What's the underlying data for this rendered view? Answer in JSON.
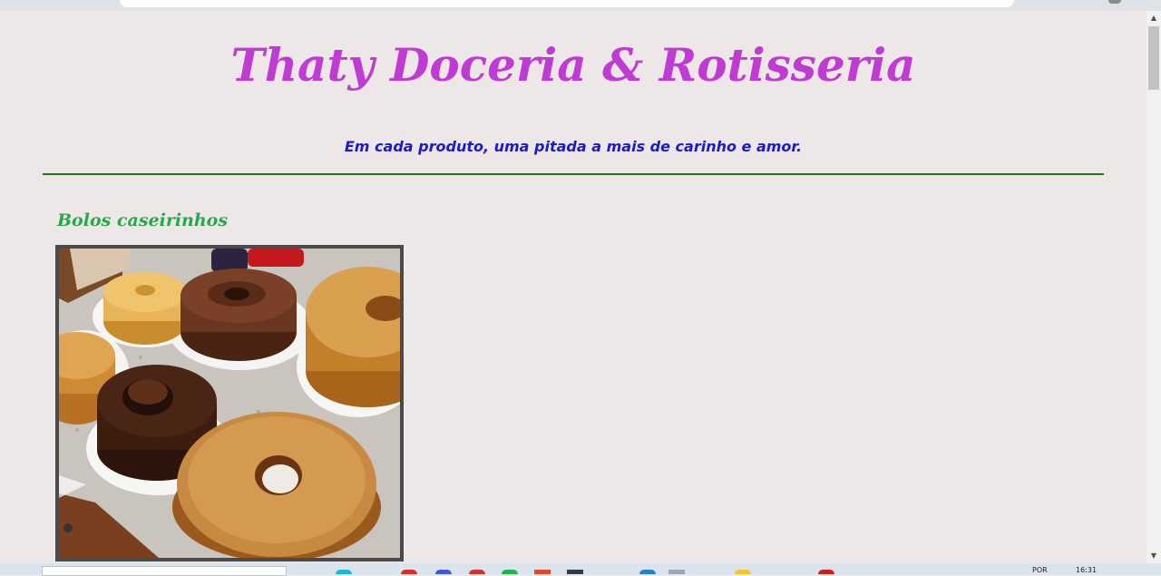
{
  "header": {
    "title": "Thaty Doceria & Rotisseria",
    "tagline": "Em cada produto, uma pitada a mais de carinho e amor."
  },
  "section": {
    "title": "Bolos caseirinhos"
  },
  "taskbar": {
    "language": "POR",
    "clock": "16:31"
  },
  "colors": {
    "page_background": "#ede7e7",
    "title": "#c03ad4",
    "tagline": "#1a1ad0",
    "divider": "#1f7a1f",
    "section_title": "#27a84a"
  },
  "icons": {
    "scroll_up": "chevron-up-icon",
    "scroll_down": "chevron-down-icon"
  }
}
